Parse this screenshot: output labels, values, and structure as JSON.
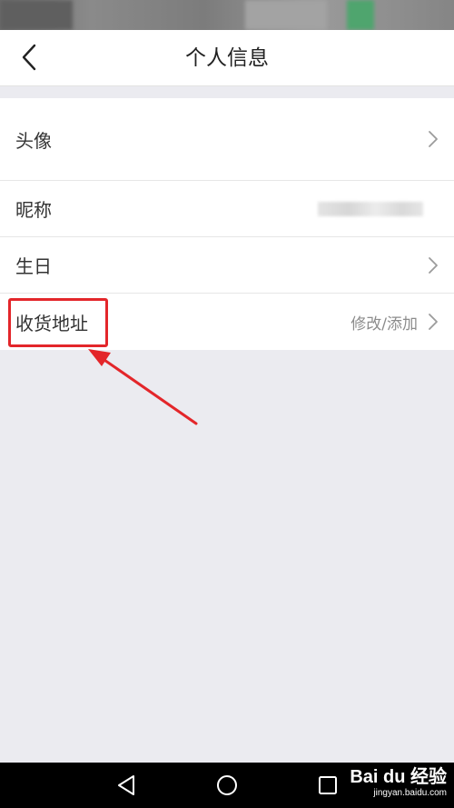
{
  "nav": {
    "title": "个人信息",
    "back_icon": "chevron-left-icon"
  },
  "profile": {
    "avatar_label": "头像",
    "nickname_label": "昵称",
    "birthday_label": "生日",
    "address_label": "收货地址",
    "address_value": "修改/添加"
  },
  "watermark": {
    "brand": "Bai du 经验",
    "site": "jingyan.baidu.com"
  },
  "colors": {
    "accent_red": "#e3262a",
    "background": "#ebebf0",
    "chevron": "#9b9b9b"
  }
}
